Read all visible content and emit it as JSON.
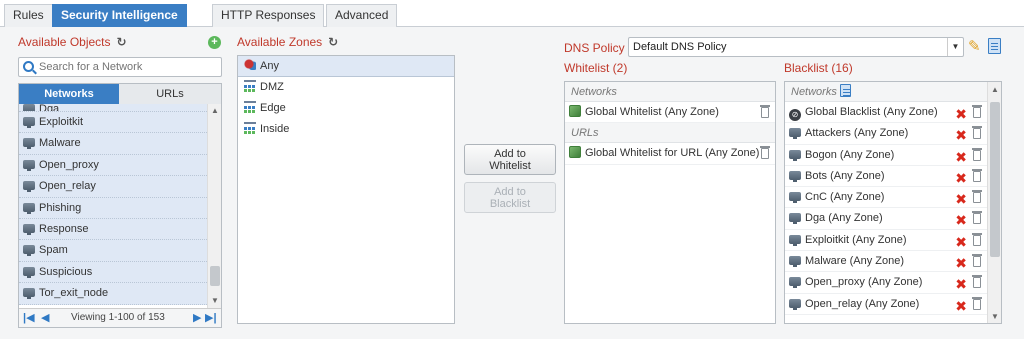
{
  "tabs": [
    {
      "label": "Rules"
    },
    {
      "label": "Security Intelligence"
    },
    {
      "label": "HTTP Responses"
    },
    {
      "label": "Advanced"
    }
  ],
  "objects": {
    "title": "Available Objects",
    "search_placeholder": "Search for a Network",
    "subtabs": {
      "networks": "Networks",
      "urls": "URLs"
    },
    "items": [
      "Dga",
      "Exploitkit",
      "Malware",
      "Open_proxy",
      "Open_relay",
      "Phishing",
      "Response",
      "Spam",
      "Suspicious",
      "Tor_exit_node"
    ],
    "pager_text": "Viewing 1-100 of 153"
  },
  "zones": {
    "title": "Available Zones",
    "items": [
      "Any",
      "DMZ",
      "Edge",
      "Inside"
    ]
  },
  "buttons": {
    "add_whitelist": "Add to\nWhitelist",
    "add_blacklist": "Add to\nBlacklist"
  },
  "dns": {
    "label": "DNS Policy",
    "value": "Default DNS Policy"
  },
  "whitelist": {
    "title": "Whitelist (2)",
    "networks_label": "Networks",
    "network_items": [
      "Global Whitelist (Any Zone)"
    ],
    "urls_label": "URLs",
    "url_items": [
      "Global Whitelist for URL (Any Zone)"
    ]
  },
  "blacklist": {
    "title": "Blacklist (16)",
    "networks_label": "Networks",
    "items": [
      "Global Blacklist (Any Zone)",
      "Attackers (Any Zone)",
      "Bogon (Any Zone)",
      "Bots (Any Zone)",
      "CnC (Any Zone)",
      "Dga (Any Zone)",
      "Exploitkit (Any Zone)",
      "Malware (Any Zone)",
      "Open_proxy (Any Zone)",
      "Open_relay (Any Zone)"
    ]
  },
  "colors": {
    "accent": "#3a7ec4",
    "header_red": "#c0392b",
    "remove_red": "#d8281c"
  }
}
